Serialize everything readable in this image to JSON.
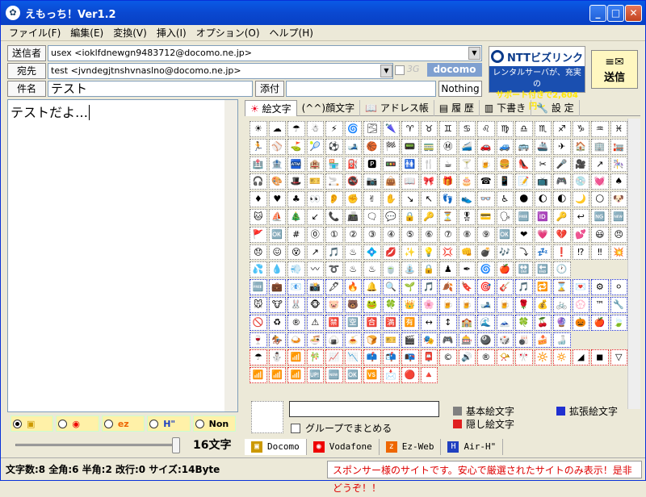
{
  "window": {
    "title": "えもっち！Ver1.2"
  },
  "menu": [
    "ファイル(F)",
    "編集(E)",
    "変換(V)",
    "挿入(I)",
    "オプション(O)",
    "ヘルプ(H)"
  ],
  "header": {
    "sender_label": "送信者",
    "sender_value": "usex <ioklfdnewgn9483712@docomo.ne.jp>",
    "to_label": "宛先",
    "to_value": "test <jvndegjtnshvnaslno@docomo.ne.jp>",
    "threeg": "3G",
    "carrier": "docomo",
    "subject_label": "件名",
    "subject_value": "テスト",
    "attach_label": "添付",
    "attach_value": "Nothing",
    "send_label": "送信"
  },
  "ad": {
    "brand": "NTTビズリンク",
    "line1": "レンタルサーバが、充実の",
    "line2": "サポート付きで2,604円〜"
  },
  "editor": {
    "text": "テストだよ…"
  },
  "carrier_radios": [
    {
      "label": "",
      "icon": "docomo-icon",
      "selected": true
    },
    {
      "label": "",
      "icon": "vodafone-icon",
      "selected": false
    },
    {
      "label": "",
      "icon": "ezweb-icon",
      "selected": false
    },
    {
      "label": "",
      "icon": "airh-icon",
      "selected": false
    },
    {
      "label": "Non",
      "icon": "",
      "selected": false
    }
  ],
  "char_count": "16文字",
  "tabs": [
    "絵文字",
    "(^^)顔文字",
    "アドレス帳",
    "履 歴",
    "下書き",
    "設 定"
  ],
  "palette": {
    "group_label": "グループでまとめる",
    "legend_basic": "基本絵文字",
    "legend_hidden": "隠し絵文字",
    "legend_ext": "拡張絵文字",
    "colors": {
      "basic": "#808080",
      "hidden": "#e02020",
      "ext": "#2030d0"
    }
  },
  "carrier_tabs": [
    "Docomo",
    "Vodafone",
    "Ez-Web",
    "Air-H\""
  ],
  "status": {
    "left": "文字数:8 全角:6 半角:2 改行:0 サイズ:14Byte",
    "right": "スポンサー様のサイトです。安心で厳選されたサイトのみ表示！是非どうぞ！！"
  },
  "emoji_rows": [
    [
      "☀",
      "☁",
      "☂",
      "☃",
      "⚡",
      "🌀",
      "🌫",
      "🌂",
      "♈",
      "♉",
      "♊",
      "♋",
      "♌",
      "♍",
      "♎",
      "♏",
      "♐",
      "♑",
      "♒",
      "♓"
    ],
    [
      "🏃",
      "⚾",
      "⛳",
      "🎾",
      "⚽",
      "🎿",
      "🏀",
      "🏁",
      "📟",
      "🚃",
      "Ⓜ",
      "🚄",
      "🚗",
      "🚙",
      "🚌",
      "🚢",
      "✈",
      "🏠",
      "🏢",
      "🏣"
    ],
    [
      "🏥",
      "🏦",
      "🏧",
      "🏨",
      "🏪",
      "⛽",
      "🅿",
      "🚥",
      "🚻",
      "🍴",
      "☕",
      "🍸",
      "🍺",
      "🍔",
      "👠",
      "✂",
      "🎤",
      "🎥",
      "↗",
      "🎠"
    ],
    [
      "🎧",
      "🎨",
      "🎩",
      "🎫",
      "🚬",
      "🚭",
      "📷",
      "👜",
      "📖",
      "🎀",
      "🎁",
      "🎂",
      "☎",
      "📱",
      "📝",
      "📺",
      "🎮",
      "💿",
      "💓",
      "♠"
    ],
    [
      "♦",
      "♥",
      "♣",
      "👀",
      "👂",
      "✊",
      "✌",
      "✋",
      "↘",
      "↖",
      "👣",
      "👟",
      "👓",
      "♿",
      "🌑",
      "🌔",
      "🌓",
      "🌙",
      "🌕",
      "🐶"
    ],
    [
      "🐱",
      "⛵",
      "🎄",
      "↙",
      "📞",
      "📠",
      "🗨",
      "💬",
      "🔒",
      "🔑",
      "⏳",
      "🎖",
      "💳",
      "🗣",
      "🆓",
      "🆔",
      "🔑",
      "↩",
      "🆖",
      "🆕"
    ],
    [
      "🚩",
      "🆗",
      "#",
      "⓪",
      "①",
      "②",
      "③",
      "④",
      "⑤",
      "⑥",
      "⑦",
      "⑧",
      "⑨",
      "🆗",
      "❤",
      "💗",
      "💔",
      "💕",
      "😃",
      "😠"
    ],
    [
      "😞",
      "😖",
      "😵",
      "↗",
      "🎵",
      "♨",
      "💠",
      "💋",
      "✨",
      "💡",
      "💢",
      "👊",
      "💣",
      "🎶",
      "⤵",
      "💤",
      "❗",
      "⁉",
      "‼",
      "💥"
    ],
    [
      "💦",
      "💧",
      "💨",
      "〰",
      "➰",
      "♨",
      "♨",
      "🍵",
      "⛲",
      "🔒",
      "♟",
      "✒",
      "🌀",
      "🍎",
      "🔛",
      "🔚",
      "🕐",
      "",
      "",
      ""
    ],
    [
      "🆓",
      "💼",
      "📧",
      "📸",
      "🖋",
      "🔥",
      "🔔",
      "🔍",
      "🌱",
      "🎵",
      "🍂",
      "🔖",
      "🎯",
      "🎸",
      "🎵",
      "🔁",
      "⌛",
      "💌",
      "⚙",
      "⚪"
    ],
    [
      "🐭",
      "🐮",
      "🐰",
      "🐵",
      "🐷",
      "🐻",
      "🐸",
      "🍀",
      "👑",
      "🌸",
      "🍺",
      "🍺",
      "🎿",
      "🍺",
      "🌹",
      "💰",
      "🚲",
      "💮",
      "™",
      "🔧"
    ],
    [
      "🚫",
      "♻",
      "®",
      "⚠",
      "🈲",
      "🈳",
      "🈴",
      "🈵",
      "🈶",
      "↔",
      "↕",
      "🏫",
      "🌊",
      "🗻",
      "🍀",
      "🍒",
      "🔮",
      "🎃",
      "🍎",
      "🍃"
    ],
    [
      "🍷",
      "🏇",
      "🍛",
      "🍜",
      "🍙",
      "🍝",
      "🍞",
      "🎫",
      "🎬",
      "🎭",
      "🎮",
      "🎰",
      "🎱",
      "🎲",
      "🎳",
      "🍰",
      "🍶",
      "",
      "",
      ""
    ],
    [
      "☂",
      "⛄",
      "📶",
      "🎋",
      "📈",
      "📉",
      "📫",
      "📬",
      "📭",
      "📮",
      "©",
      "🔊",
      "®",
      "📯",
      "🎌",
      "🔆",
      "🔅",
      "◢",
      "◼",
      "▽"
    ],
    [
      "📶",
      "📶",
      "📶",
      "🆙",
      "🆕",
      "🆗",
      "🆚",
      "📩",
      "🔴",
      "🔺",
      "",
      "",
      "",
      "",
      "",
      "",
      "",
      "",
      "",
      ""
    ]
  ]
}
